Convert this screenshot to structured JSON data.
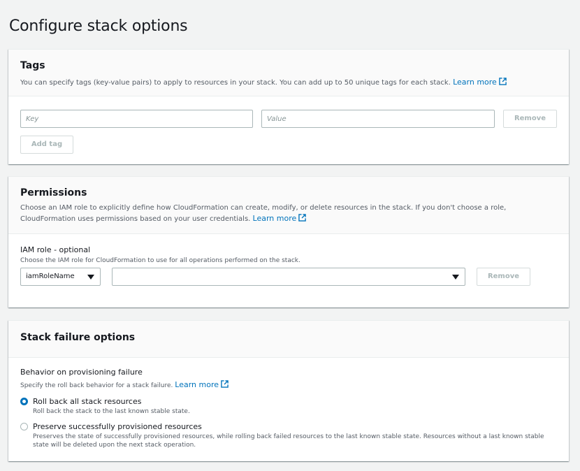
{
  "page": {
    "title": "Configure stack options"
  },
  "tags": {
    "title": "Tags",
    "description": "You can specify tags (key-value pairs) to apply to resources in your stack. You can add up to 50 unique tags for each stack.",
    "learn_more": "Learn more",
    "key_placeholder": "Key",
    "value_placeholder": "Value",
    "remove_label": "Remove",
    "add_tag_label": "Add tag"
  },
  "permissions": {
    "title": "Permissions",
    "description": "Choose an IAM role to explicitly define how CloudFormation can create, modify, or delete resources in the stack. If you don't choose a role, CloudFormation uses permissions based on your user credentials.",
    "learn_more": "Learn more",
    "iam_role_label": "IAM role - optional",
    "iam_role_desc": "Choose the IAM role for CloudFormation to use for all operations performed on the stack.",
    "role_type_selected": "iamRoleName",
    "role_value_selected": "",
    "remove_label": "Remove"
  },
  "failure": {
    "title": "Stack failure options",
    "behavior_label": "Behavior on provisioning failure",
    "behavior_desc": "Specify the roll back behavior for a stack failure.",
    "learn_more": "Learn more",
    "option1_label": "Roll back all stack resources",
    "option1_desc": "Roll back the stack to the last known stable state.",
    "option2_label": "Preserve successfully provisioned resources",
    "option2_desc": "Preserves the state of successfully provisioned resources, while rolling back failed resources to the last known stable state. Resources without a last known stable state will be deleted upon the next stack operation.",
    "selected_option": "option1"
  },
  "colors": {
    "link": "#0073bb",
    "radio_selected": "#0073bb"
  },
  "icons": {
    "external_link": "external-link-icon",
    "caret": "caret-down-icon"
  }
}
